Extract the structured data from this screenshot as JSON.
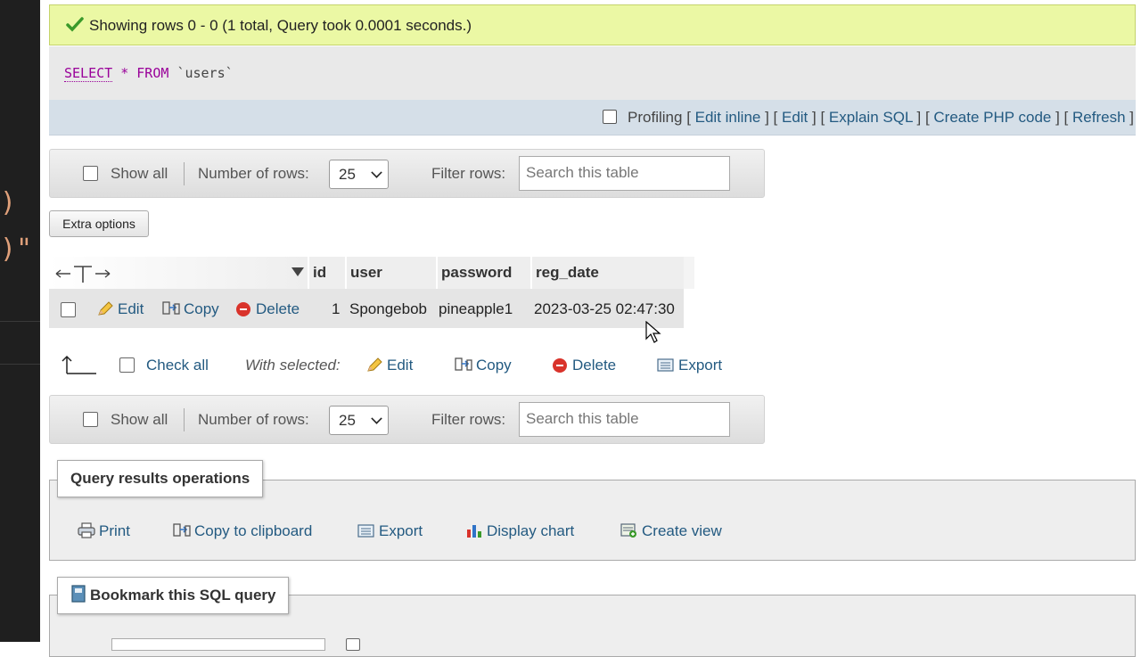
{
  "success": {
    "message": "Showing rows 0 - 0 (1 total, Query took 0.0001 seconds.)"
  },
  "sql": {
    "select": "SELECT",
    "star": "*",
    "from": "FROM",
    "table": "`users`"
  },
  "sql_toolbar": {
    "profiling": "Profiling",
    "links": [
      "Edit inline",
      "Edit",
      "Explain SQL",
      "Create PHP code",
      "Refresh"
    ]
  },
  "navigation": {
    "show_all": "Show all",
    "number_of_rows": "Number of rows:",
    "rows_value": "25",
    "filter_rows": "Filter rows:",
    "search_placeholder": "Search this table"
  },
  "extra_options": "Extra options",
  "table": {
    "columns": [
      "id",
      "user",
      "password",
      "reg_date"
    ],
    "row_actions": {
      "edit": "Edit",
      "copy": "Copy",
      "delete": "Delete"
    },
    "rows": [
      {
        "id": "1",
        "user": "Spongebob",
        "password": "pineapple1",
        "reg_date": "2023-03-25 02:47:30"
      }
    ]
  },
  "with_selected": {
    "check_all": "Check all",
    "label": "With selected:",
    "edit": "Edit",
    "copy": "Copy",
    "delete": "Delete",
    "export": "Export"
  },
  "query_results_operations": {
    "title": "Query results operations",
    "print": "Print",
    "copy_to_clipboard": "Copy to clipboard",
    "export": "Export",
    "display_chart": "Display chart",
    "create_view": "Create view"
  },
  "bookmark": {
    "title": "Bookmark this SQL query"
  },
  "colors": {
    "success_bg": "#ebf8a4",
    "link": "#235a81",
    "delete": "#d9332b",
    "sql_keyword": "#990099"
  }
}
